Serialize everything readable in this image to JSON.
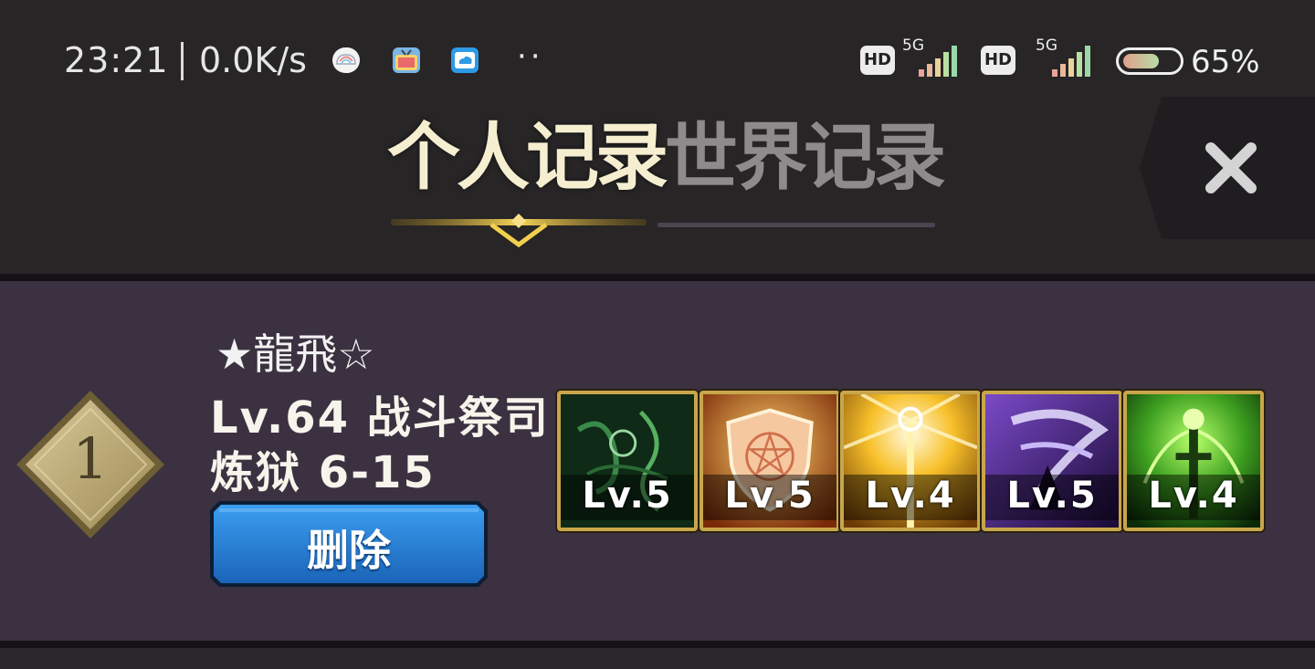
{
  "status_bar": {
    "time": "23:21",
    "net_speed": "0.0K/s",
    "dots": "··",
    "hd1": "HD",
    "g1": "5G",
    "hd2": "HD",
    "g2": "5G",
    "battery_pct": "65%",
    "battery_level": 0.65
  },
  "tabs": {
    "personal": "个人记录",
    "world": "世界记录",
    "active": "personal"
  },
  "record": {
    "rank": "1",
    "name": "★龍飛☆",
    "level_class": "Lv.64 战斗祭司",
    "stage": "炼狱 6-15",
    "delete_label": "删除",
    "skills": [
      {
        "level": "Lv.5",
        "icon": "vine-curse-icon"
      },
      {
        "level": "Lv.5",
        "icon": "shield-pentagram-icon"
      },
      {
        "level": "Lv.4",
        "icon": "holy-staff-light-icon"
      },
      {
        "level": "Lv.5",
        "icon": "shadow-strike-icon"
      },
      {
        "level": "Lv.4",
        "icon": "nature-totem-icon"
      }
    ]
  },
  "colors": {
    "background": "#272526",
    "panel": "#3b3140",
    "tab_active": "#f6eed0",
    "tab_inactive": "#8e8b8d",
    "button_blue": "#1e73c8",
    "gold": "#c8a64a"
  }
}
